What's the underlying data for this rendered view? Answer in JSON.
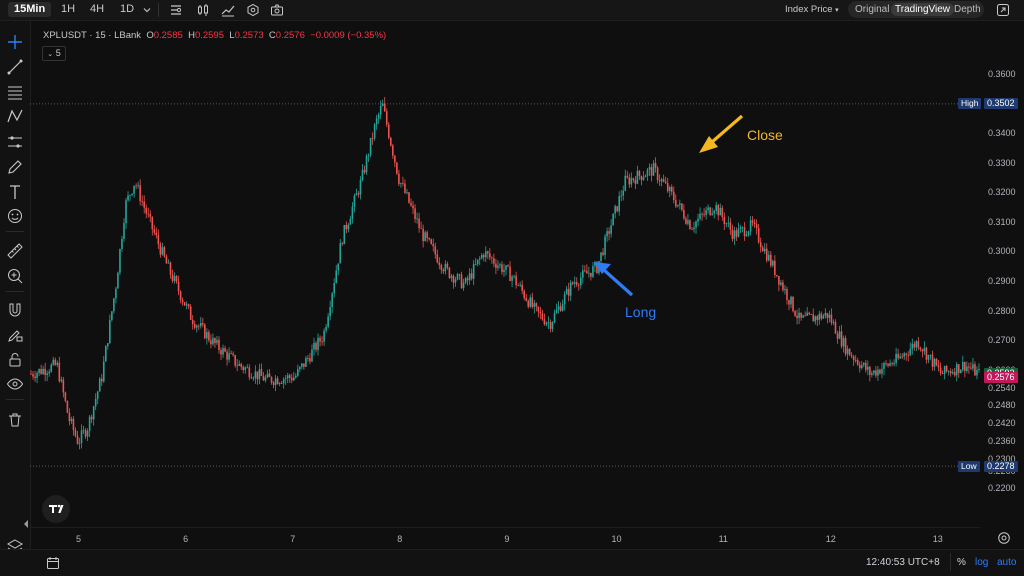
{
  "toolbar": {
    "timeframes": [
      "15Min",
      "1H",
      "4H",
      "1D"
    ],
    "active_timeframe": "15Min",
    "price_source": "Index Price",
    "views": [
      "Original",
      "TradingView",
      "Depth"
    ],
    "active_view": "TradingView"
  },
  "legend": {
    "symbol": "XPLUSDT · 15 · LBank",
    "open_label": "O",
    "open": "0.2585",
    "high_label": "H",
    "high": "0.2595",
    "low_label": "L",
    "low": "0.2573",
    "close_label": "C",
    "close": "0.2576",
    "change": "−0.0009 (−0.35%)",
    "indicators_count": "5"
  },
  "annotations": {
    "long": "Long",
    "close": "Close"
  },
  "colors": {
    "up": "#26a69a",
    "down": "#ef5350",
    "long_arrow": "#2f7cf6",
    "close_arrow": "#f5b920",
    "high_low_label": "#1e3a6e"
  },
  "chart_data": {
    "type": "candlestick",
    "symbol": "XPLUSDT",
    "interval": "15",
    "x_ticks": [
      "5",
      "6",
      "7",
      "8",
      "9",
      "10",
      "11",
      "12",
      "13"
    ],
    "y_ticks": [
      "0.3600",
      "0.3500",
      "0.3400",
      "0.3300",
      "0.3200",
      "0.3100",
      "0.3000",
      "0.2900",
      "0.2800",
      "0.2700",
      "0.2600",
      "0.2540",
      "0.2480",
      "0.2420",
      "0.2360",
      "0.2300",
      "0.2260",
      "0.2200"
    ],
    "ylim": [
      0.218,
      0.366
    ],
    "high_label": "High",
    "high": 0.3502,
    "high_text": "0.3502",
    "low_label": "Low",
    "low": 0.2278,
    "low_text": "0.2278",
    "last_close_text": "0.2576",
    "last_other_text": "0.2592",
    "path_prices": [
      [
        0,
        0.259
      ],
      [
        0.55,
        0.262
      ],
      [
        0.8,
        0.244
      ],
      [
        1.0,
        0.236
      ],
      [
        1.2,
        0.241
      ],
      [
        1.5,
        0.258
      ],
      [
        1.8,
        0.289
      ],
      [
        2.0,
        0.316
      ],
      [
        2.2,
        0.324
      ],
      [
        2.5,
        0.311
      ],
      [
        2.9,
        0.295
      ],
      [
        3.4,
        0.278
      ],
      [
        3.9,
        0.269
      ],
      [
        4.4,
        0.262
      ],
      [
        5.0,
        0.257
      ],
      [
        5.6,
        0.258
      ],
      [
        6.2,
        0.272
      ],
      [
        6.6,
        0.305
      ],
      [
        7.0,
        0.324
      ],
      [
        7.3,
        0.343
      ],
      [
        7.45,
        0.35
      ],
      [
        7.8,
        0.325
      ],
      [
        8.3,
        0.306
      ],
      [
        8.8,
        0.294
      ],
      [
        9.2,
        0.289
      ],
      [
        9.6,
        0.3
      ],
      [
        10.2,
        0.292
      ],
      [
        10.7,
        0.28
      ],
      [
        11.0,
        0.276
      ],
      [
        11.5,
        0.29
      ],
      [
        12.0,
        0.295
      ],
      [
        12.6,
        0.324
      ],
      [
        13.2,
        0.328
      ],
      [
        13.6,
        0.319
      ],
      [
        14.0,
        0.309
      ],
      [
        14.5,
        0.316
      ],
      [
        14.9,
        0.306
      ],
      [
        15.3,
        0.309
      ],
      [
        15.8,
        0.293
      ],
      [
        16.3,
        0.277
      ],
      [
        16.9,
        0.279
      ],
      [
        17.3,
        0.267
      ],
      [
        17.8,
        0.259
      ],
      [
        18.4,
        0.264
      ],
      [
        18.8,
        0.27
      ],
      [
        19.3,
        0.259
      ],
      [
        19.8,
        0.262
      ],
      [
        20.1,
        0.259
      ]
    ],
    "x_range": [
      0,
      20.1
    ]
  },
  "bottom": {
    "time": "12:40:53 UTC+8",
    "percent": "%",
    "log": "log",
    "auto": "auto"
  }
}
